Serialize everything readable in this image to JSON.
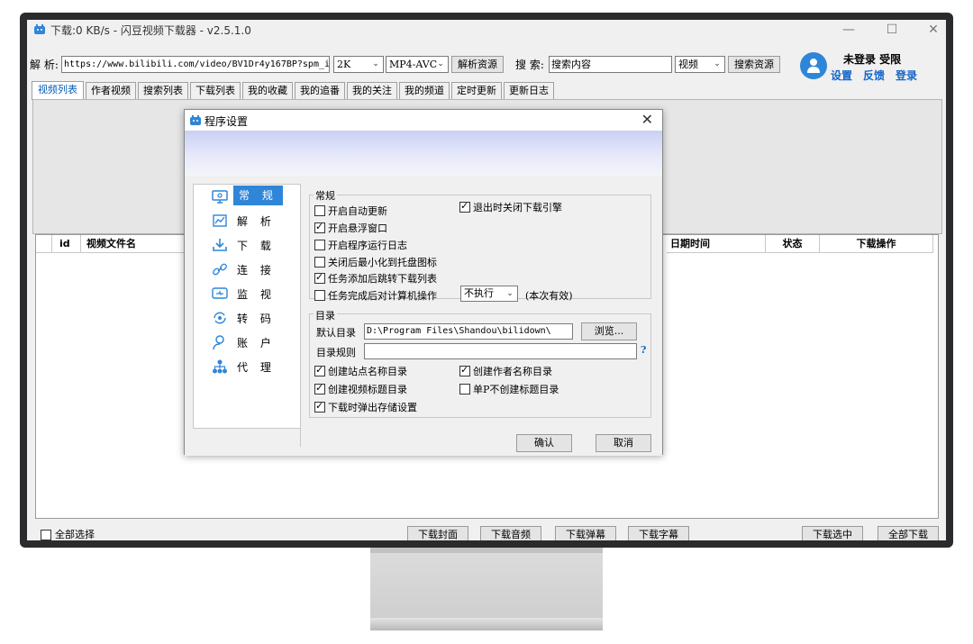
{
  "window": {
    "title": "下载:0 KB/s - 闪豆视频下载器 - v2.5.1.0"
  },
  "toolbar": {
    "parse_label": "解 析:",
    "url_value": "https://www.bilibili.com/video/BV1Dr4y167BP?spm_i",
    "quality_value": "2K",
    "codec_value": "MP4-AVC",
    "parse_button": "解析资源",
    "search_label": "搜 索:",
    "search_placeholder": "搜索内容",
    "search_type_value": "视频",
    "search_button": "搜索资源"
  },
  "user": {
    "status": "未登录 受限",
    "links": [
      "设置",
      "反馈",
      "登录"
    ]
  },
  "tabs": [
    {
      "label": "视频列表",
      "active": true
    },
    {
      "label": "作者视频"
    },
    {
      "label": "搜索列表"
    },
    {
      "label": "下载列表"
    },
    {
      "label": "我的收藏"
    },
    {
      "label": "我的追番"
    },
    {
      "label": "我的关注"
    },
    {
      "label": "我的频道"
    },
    {
      "label": "定时更新"
    },
    {
      "label": "更新日志"
    }
  ],
  "table": {
    "columns": [
      "id",
      "视频文件名",
      "日期时间",
      "状态",
      "下载操作"
    ]
  },
  "bottom": {
    "select_all": "全部选择",
    "buttons": [
      "下载封面",
      "下载音频",
      "下载弹幕",
      "下载字幕",
      "下载选中",
      "全部下载"
    ]
  },
  "dialog": {
    "title": "程序设置",
    "nav": [
      {
        "label": "常 规",
        "icon": "monitor-settings-icon",
        "active": true
      },
      {
        "label": "解 析",
        "icon": "chart-icon"
      },
      {
        "label": "下 载",
        "icon": "download-icon"
      },
      {
        "label": "连 接",
        "icon": "link-icon"
      },
      {
        "label": "监 视",
        "icon": "monitor-icon"
      },
      {
        "label": "转 码",
        "icon": "convert-icon"
      },
      {
        "label": "账 户",
        "icon": "user-icon"
      },
      {
        "label": "代 理",
        "icon": "proxy-network-icon"
      }
    ],
    "general": {
      "title": "常规",
      "options": [
        {
          "label": "开启自动更新",
          "checked": false
        },
        {
          "label": "退出时关闭下载引擎",
          "checked": true
        },
        {
          "label": "开启悬浮窗口",
          "checked": true
        },
        {
          "label": "开启程序运行日志",
          "checked": false
        },
        {
          "label": "关闭后最小化到托盘图标",
          "checked": false
        },
        {
          "label": "任务添加后跳转下载列表",
          "checked": true
        },
        {
          "label": "任务完成后对计算机操作",
          "checked": false
        }
      ],
      "action_value": "不执行",
      "action_note": "(本次有效)"
    },
    "directory": {
      "title": "目录",
      "default_label": "默认目录",
      "default_value": "D:\\Program Files\\Shandou\\bilidown\\",
      "browse_button": "浏览...",
      "rule_label": "目录规则",
      "rule_value": "",
      "help": "?",
      "options": [
        {
          "label": "创建站点名称目录",
          "checked": true
        },
        {
          "label": "创建作者名称目录",
          "checked": true
        },
        {
          "label": "创建视频标题目录",
          "checked": true
        },
        {
          "label": "单P不创建标题目录",
          "checked": false
        },
        {
          "label": "下载时弹出存储设置",
          "checked": true
        }
      ]
    },
    "ok_button": "确认",
    "cancel_button": "取消"
  },
  "colors": {
    "accent": "#2f86d8",
    "link": "#1466c8",
    "frame": "#2b2b2d"
  }
}
